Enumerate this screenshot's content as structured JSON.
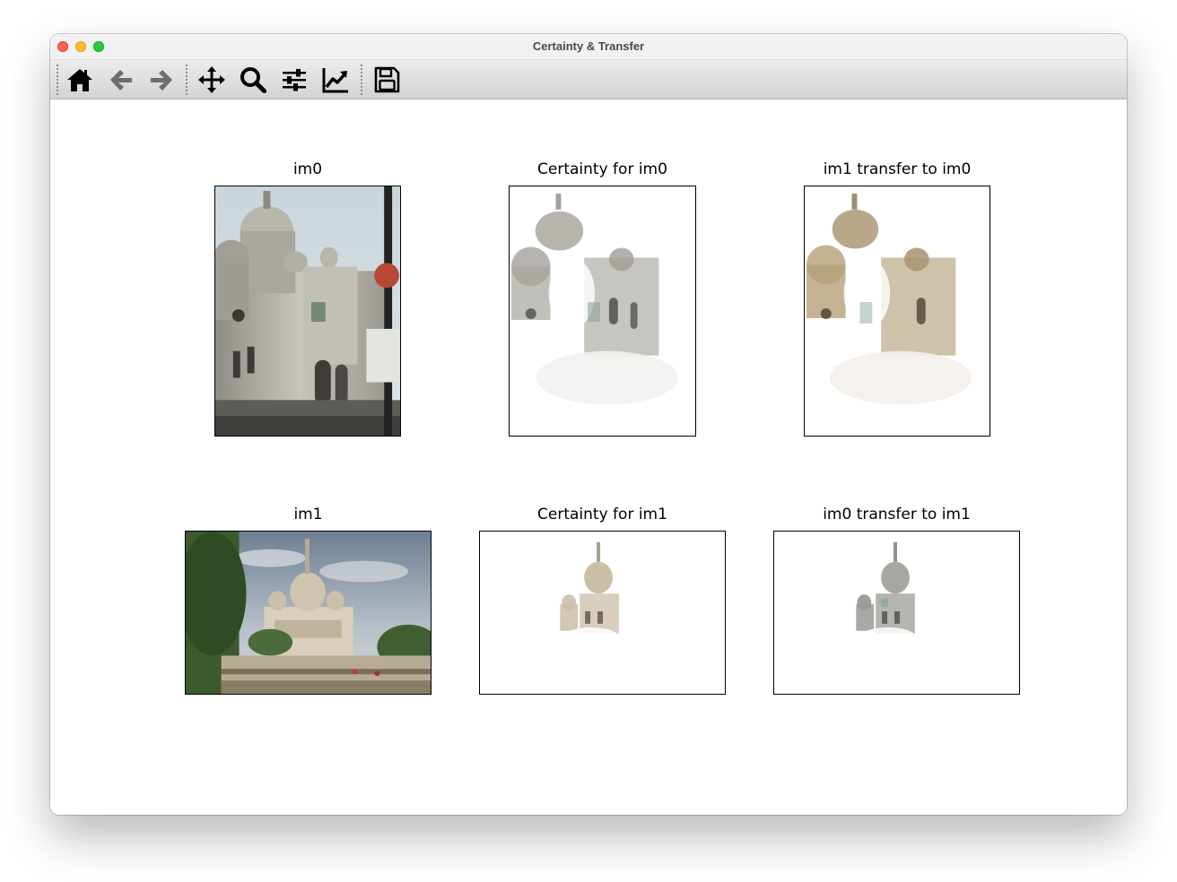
{
  "window": {
    "title": "Certainty & Transfer",
    "colors": {
      "close": "#fe5f57",
      "minimize": "#febc2e",
      "maximize": "#28c840"
    }
  },
  "toolbar": {
    "tools": [
      {
        "name": "home",
        "icon": "home-icon"
      },
      {
        "name": "back",
        "icon": "arrow-left-icon"
      },
      {
        "name": "forward",
        "icon": "arrow-right-icon"
      },
      {
        "name": "pan",
        "icon": "move-icon"
      },
      {
        "name": "zoom",
        "icon": "search-icon"
      },
      {
        "name": "configure-subplots",
        "icon": "sliders-icon"
      },
      {
        "name": "edit-axis",
        "icon": "line-chart-icon"
      },
      {
        "name": "save",
        "icon": "floppy-disk-icon"
      }
    ]
  },
  "figure": {
    "subplots": [
      {
        "title": "im0",
        "content": "photo"
      },
      {
        "title": "Certainty for im0",
        "content": "masked"
      },
      {
        "title": "im1 transfer to im0",
        "content": "masked"
      },
      {
        "title": "im1",
        "content": "photo"
      },
      {
        "title": "Certainty for im1",
        "content": "masked"
      },
      {
        "title": "im0 transfer to im1",
        "content": "masked"
      }
    ]
  }
}
